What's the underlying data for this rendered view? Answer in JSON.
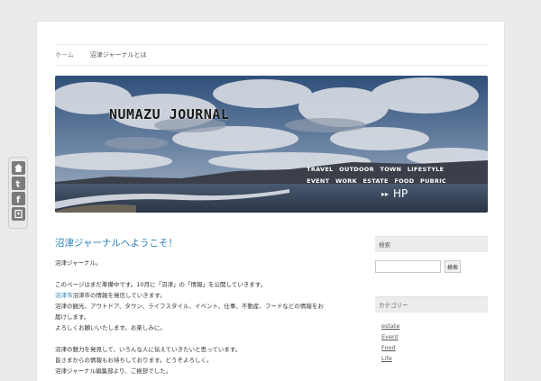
{
  "nav": {
    "home": "ホーム",
    "item": "沼津ジャーナルとは"
  },
  "banner": {
    "title": "NUMAZU JOURNAL",
    "row1": [
      "TRAVEL",
      "OUTDOOR",
      "TOWN",
      "LIFESTYLE"
    ],
    "row2": [
      "EVENT",
      "WORK",
      "ESTATE",
      "FOOD",
      "PUBRIC"
    ],
    "hp": "HP"
  },
  "entry": {
    "title": "沼津ジャーナルへようこそ！",
    "lines": [
      "沼津ジャーナル。",
      "",
      "このページはまだ準備中です。10月に「沼津」の「情報」を公開していきます。",
      "沼津市の情報を発信していきます。",
      "沼津の観光、アウトドア、タウン、ライフスタイル、イベント、仕事、不動産、フードなどの情報をお届けします。",
      "よろしくお願いいたします。お楽しみに。",
      "",
      "沼津の魅力を発見して、いろんな人に伝えていきたいと思っています。",
      "皆さまからの情報もお待ちしております。どうぞよろしく。",
      "沼津ジャーナル編集部より、ご挨拶でした。"
    ],
    "link_text": "沼津市"
  },
  "sidebar": {
    "search_head": "検索",
    "search_button": "検索",
    "search_value": "",
    "cat_head": "カテゴリー",
    "categories": [
      "estate",
      "Event",
      "Food",
      "Life"
    ]
  },
  "share": {
    "icons": [
      "home-icon",
      "twitter-icon",
      "facebook-icon",
      "bookmark-icon"
    ]
  }
}
